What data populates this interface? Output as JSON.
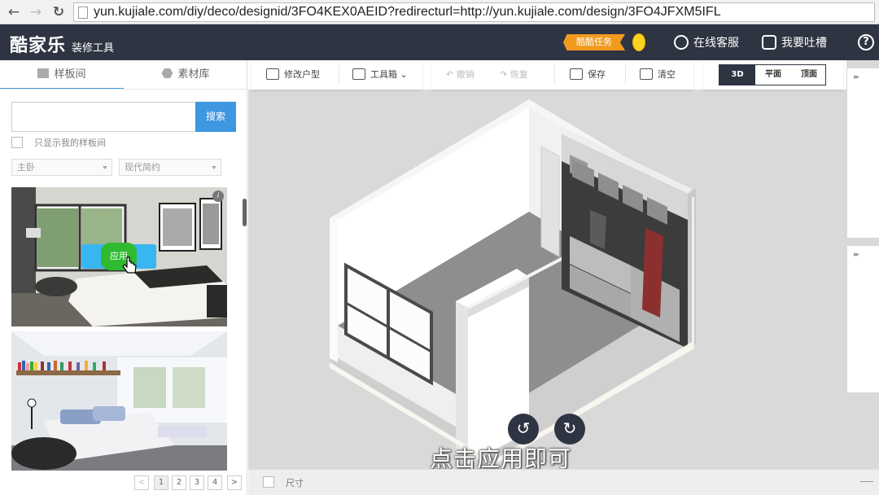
{
  "browser": {
    "url": "yun.kujiale.com/diy/deco/designid/3FO4KEX0AEID?redirecturl=http://yun.kujiale.com/design/3FO4JFXM5IFL"
  },
  "header": {
    "logo": "酷家乐",
    "logo_sub": "装修工具",
    "task_badge": "酷酷任务",
    "customer_service": "在线客服",
    "feedback": "我要吐槽",
    "help": "?"
  },
  "left_panel": {
    "tabs": [
      {
        "label": "样板间"
      },
      {
        "label": "素材库"
      }
    ],
    "search": {
      "placeholder": "",
      "button": "搜索"
    },
    "only_mine_label": "只显示我的样板间",
    "filters": [
      "主卧",
      "现代简约"
    ],
    "apply_label": "应用",
    "info": "i",
    "pagination": {
      "prev": "<",
      "pages": [
        "1",
        "2",
        "3",
        "4"
      ],
      "next": ">"
    }
  },
  "toolbar": {
    "edit_layout": "修改户型",
    "toolbox": "工具箱",
    "undo": "撤销",
    "redo": "恢复",
    "save": "保存",
    "clear": "清空",
    "views": [
      "3D",
      "平面",
      "顶面"
    ]
  },
  "canvas": {
    "caption": "点击应用即可",
    "rotate_left": "↺",
    "rotate_right": "↻"
  },
  "right_panel": {
    "collapse": "▸▸"
  },
  "bottom_bar": {
    "size_label": "尺寸"
  },
  "colors": {
    "header_bg": "#2e3442",
    "accent": "#3e97e0",
    "apply_green": "#2fba2f",
    "task_orange": "#f29a1e"
  }
}
